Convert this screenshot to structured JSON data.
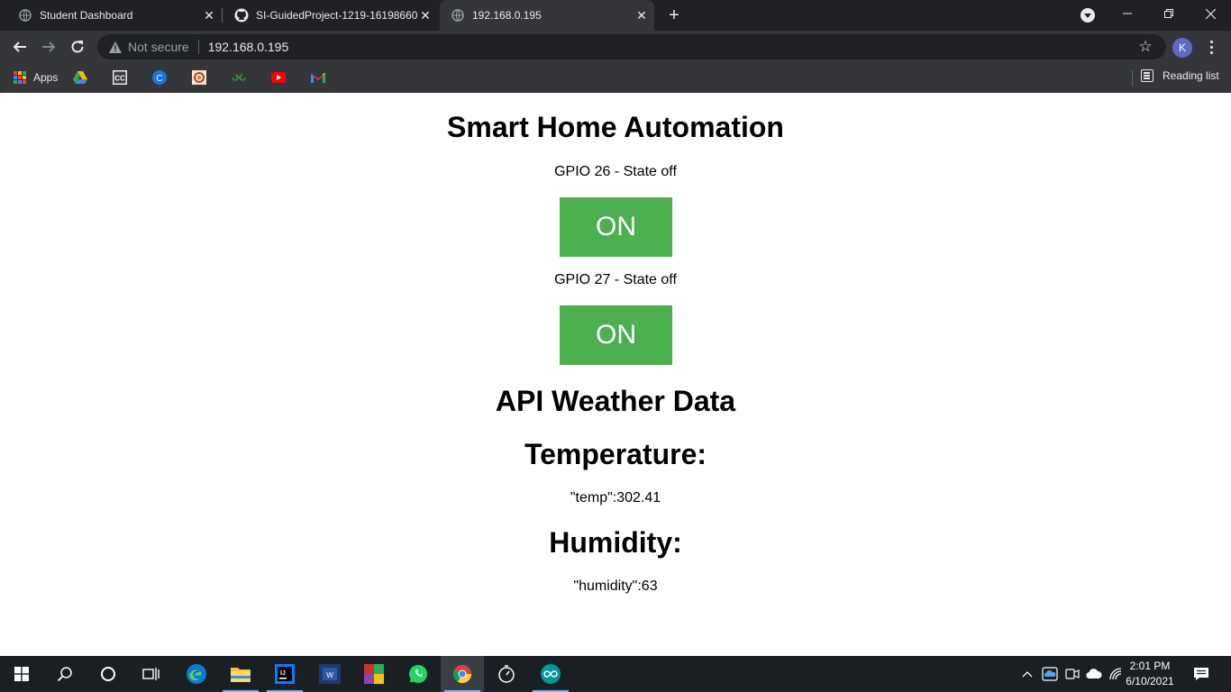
{
  "browser": {
    "tabs": [
      {
        "title": "Student Dashboard",
        "icon": "globe-icon",
        "active": false
      },
      {
        "title": "SI-GuidedProject-1219-16198660",
        "icon": "github-icon",
        "active": false
      },
      {
        "title": "192.168.0.195",
        "icon": "globe-icon",
        "active": true
      }
    ],
    "address": {
      "security_label": "Not secure",
      "url": "192.168.0.195"
    },
    "profile_initial": "K",
    "bookmarks": {
      "apps_label": "Apps",
      "items": [
        "google-drive-icon",
        "cc-icon",
        "c-circle-icon",
        "coursera-icon",
        "geeksforgeeks-icon",
        "youtube-icon",
        "gmail-icon"
      ]
    },
    "reading_list_label": "Reading list"
  },
  "page": {
    "title": "Smart Home Automation",
    "gpio": [
      {
        "label": "GPIO 26 - State off",
        "button_label": "ON"
      },
      {
        "label": "GPIO 27 - State off",
        "button_label": "ON"
      }
    ],
    "weather_heading": "API Weather Data",
    "temperature_heading": "Temperature:",
    "temperature_value": "\"temp\":302.41",
    "humidity_heading": "Humidity:",
    "humidity_value": "\"humidity\":63"
  },
  "taskbar": {
    "time": "2:01 PM",
    "date": "6/10/2021",
    "apps": [
      "windows-start-icon",
      "search-icon",
      "cortana-icon",
      "task-view-icon",
      "edge-icon",
      "file-explorer-icon",
      "intellij-icon",
      "visual-studio-icon",
      "winrar-icon",
      "whatsapp-icon",
      "chrome-icon",
      "timer-icon",
      "arduino-icon"
    ]
  },
  "colors": {
    "button_green": "#4caf50",
    "chrome_dark": "#202124",
    "chrome_toolbar": "#35363a",
    "taskbar": "#1a1f24"
  }
}
